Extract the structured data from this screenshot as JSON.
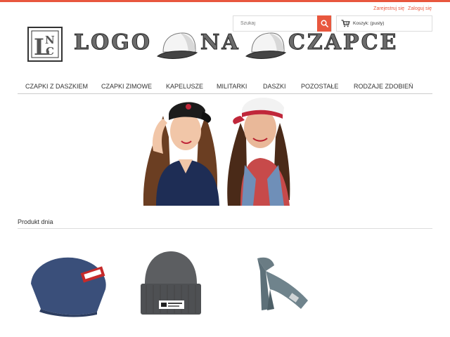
{
  "header": {
    "account_links": {
      "register": "Zarejestruj się",
      "login": "Zaloguj się"
    },
    "search": {
      "placeholder": "Szukaj",
      "icon": "search-icon"
    },
    "cart": {
      "label": "Koszyk: (pusty)",
      "icon": "cart-icon"
    },
    "logo": {
      "mark": "LNC",
      "words": [
        "LOGO",
        "NA",
        "CZAPCE"
      ]
    }
  },
  "nav": {
    "items": [
      {
        "label": "CZAPKI Z DASZKIEM"
      },
      {
        "label": "CZAPKI ZIMOWE"
      },
      {
        "label": "KAPELUSZE"
      },
      {
        "label": "MILITARKI"
      },
      {
        "label": "DASZKI"
      },
      {
        "label": "POZOSTAŁE"
      },
      {
        "label": "RODZAJE ZDOBIEŃ"
      }
    ]
  },
  "section": {
    "title": "Produkt dnia"
  },
  "products": [
    {
      "name": "beanie-blue"
    },
    {
      "name": "beanie-grey"
    },
    {
      "name": "scarf-grey"
    }
  ],
  "colors": {
    "accent": "#e8573e",
    "logo_fill": "#6b6b6b"
  }
}
